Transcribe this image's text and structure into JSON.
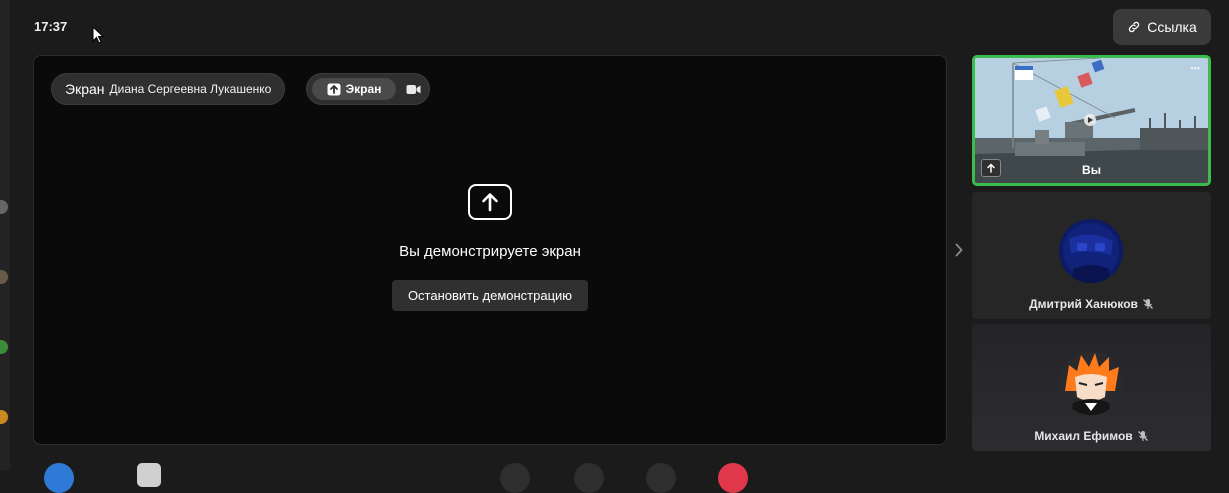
{
  "status": {
    "clock": "17:37"
  },
  "header": {
    "link_label": "Ссылка"
  },
  "stage": {
    "pill_label_big": "Экран",
    "pill_label_name": "Диана Сергеевна Лукашенко",
    "source_screen_label": "Экран",
    "share_message": "Вы демонстрируете экран",
    "stop_button_label": "Остановить демонстрацию"
  },
  "participants": [
    {
      "label": "Вы"
    },
    {
      "name": "Дмитрий Ханюков"
    },
    {
      "name": "Михаил Ефимов"
    }
  ],
  "colors": {
    "active_speaker_border": "#3bbd4e",
    "background": "#1b1b1b",
    "stage_background": "#0a0a0a"
  },
  "icons": {
    "link": "link-icon",
    "share": "arrow-up-box-icon",
    "camera": "video-camera-icon",
    "mic_off": "mic-off-icon",
    "chevron": "chevron-right-icon"
  }
}
